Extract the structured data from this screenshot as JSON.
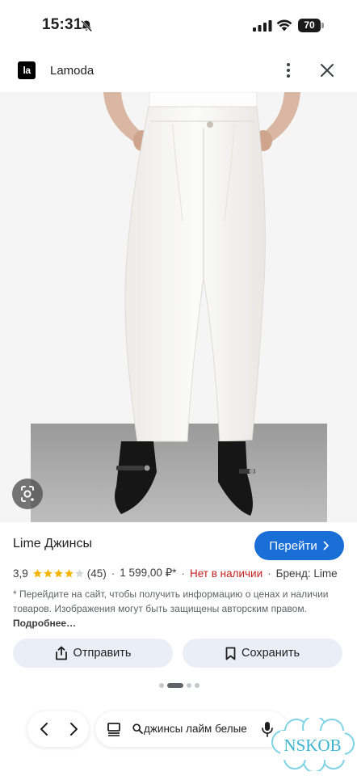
{
  "status_bar": {
    "time": "15:31",
    "battery": "70",
    "icons": [
      "bell-off-icon",
      "signal-icon",
      "wifi-icon",
      "battery-icon"
    ]
  },
  "site": {
    "logo_text": "la",
    "name": "Lamoda"
  },
  "product": {
    "title": "Lime Джинсы",
    "cta_label": "Перейти",
    "rating": "3,9",
    "rating_value": 3.9,
    "rating_max": 5,
    "reviews": "(45)",
    "price": "1 599,00 ₽*",
    "stock": "Нет в наличии",
    "brand": "Бренд: Lime",
    "disclaimer": "* Перейдите на сайт, чтобы получить информацию о ценах и наличии товаров. Изображения могут быть защищены авторским правом.",
    "more_label": "Подробнее…"
  },
  "actions": {
    "share_label": "Отправить",
    "save_label": "Сохранить"
  },
  "pager": {
    "count": 4,
    "active": 1
  },
  "bottom_bar": {
    "query": "джинсы лайм белые"
  },
  "watermark": {
    "text": "NSKOB"
  },
  "colors": {
    "accent": "#1a6fd6",
    "stock_red": "#c5221f",
    "star": "#f4b400",
    "chip_bg": "#e9eef7"
  }
}
